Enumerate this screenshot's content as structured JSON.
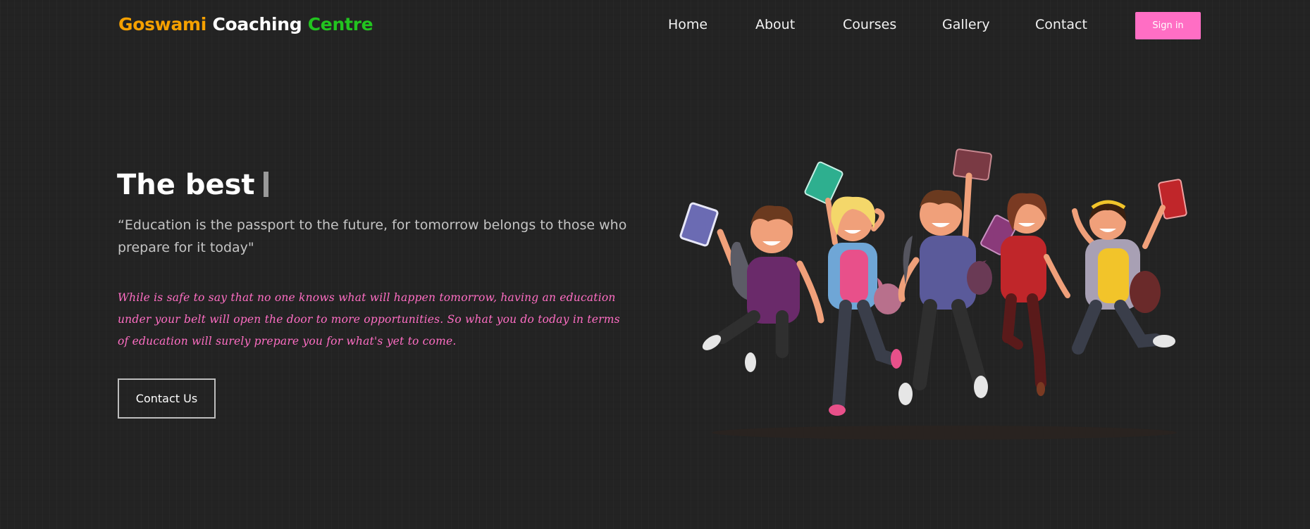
{
  "brand": {
    "part1": "Goswami",
    "part2": "Coaching",
    "part3": "Centre"
  },
  "nav": {
    "links": [
      "Home",
      "About",
      "Courses",
      "Gallery",
      "Contact"
    ],
    "sign_in": "Sign in"
  },
  "hero": {
    "title": "The best",
    "quote": "“Education is the passport to the future, for tomorrow belongs to those who prepare for it today\"",
    "script_text": "While is safe to say that no one knows what will happen tomorrow, having an education under your belt will open the door to more opportunities. So what you do today in terms of education will surely prepare you for what's yet to come.",
    "contact_button": "Contact Us"
  },
  "colors": {
    "background": "#232323",
    "brand_orange": "#f5a000",
    "brand_green": "#22c41f",
    "accent_pink": "#ff6ec4"
  },
  "icons": {
    "illustration": "jumping-students-illustration"
  }
}
